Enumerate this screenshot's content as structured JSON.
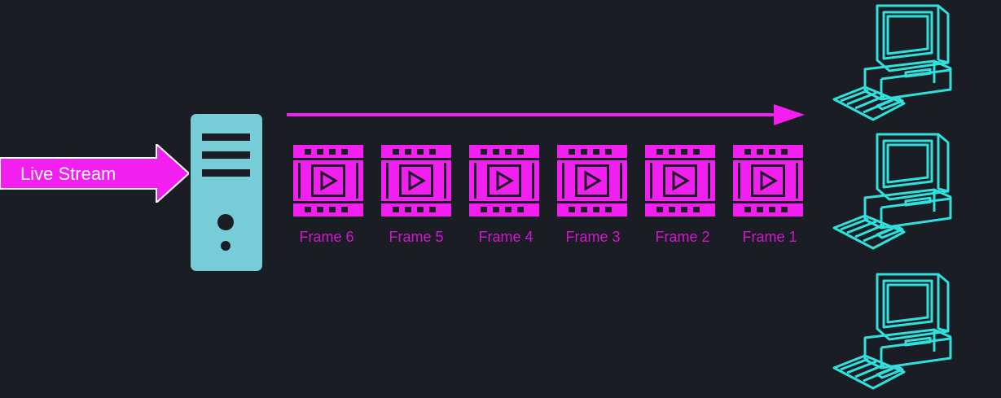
{
  "colors": {
    "background": "#1a1d23",
    "accent_magenta": "#f21ff0",
    "label_magenta": "#d317cf",
    "server_cyan": "#76cdd8",
    "computer_cyan": "#2fe0dc"
  },
  "input": {
    "label": "Live Stream"
  },
  "frames": [
    {
      "label": "Frame 6"
    },
    {
      "label": "Frame 5"
    },
    {
      "label": "Frame 4"
    },
    {
      "label": "Frame 3"
    },
    {
      "label": "Frame 2"
    },
    {
      "label": "Frame 1"
    }
  ],
  "icons": {
    "input_arrow": "arrow-right-icon",
    "server": "server-icon",
    "flow": "arrow-right-icon",
    "frame": "film-frame-icon",
    "client": "desktop-computer-icon"
  },
  "clients_count": 3
}
